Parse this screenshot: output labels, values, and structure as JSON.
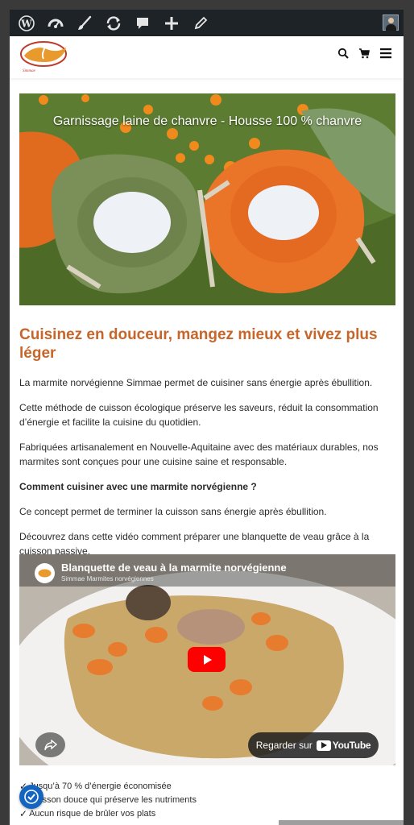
{
  "adminbar": {
    "icons": [
      "wordpress-icon",
      "dashboard-icon",
      "customize-brush-icon",
      "updates-icon",
      "comments-icon",
      "new-content-icon",
      "edit-pencil-icon"
    ],
    "avatar": "user-avatar"
  },
  "header": {
    "logo_text": "Simmae",
    "icons": [
      "search-icon",
      "cart-icon",
      "menu-icon"
    ]
  },
  "hero": {
    "caption": "Garnissage laine de chanvre - Housse 100 % chanvre"
  },
  "article": {
    "heading": "Cuisinez en douceur, mangez mieux et vivez plus léger",
    "paragraphs": [
      "La marmite norvégienne Simmae permet de cuisiner sans énergie après ébullition.",
      "Cette méthode de cuisson écologique préserve les saveurs, réduit la consommation d’énergie et facilite la cuisine du quotidien.",
      "Fabriquées artisanalement en Nouvelle-Aquitaine avec des matériaux durables, nos marmites sont conçues pour une cuisine saine et responsable.",
      "Comment cuisiner avec une marmite norvégienne ?",
      "Ce concept permet de terminer la cuisson sans énergie après ébullition.",
      "Découvrez dans cette vidéo comment préparer une blanquette de veau grâce à la cuisson passive."
    ]
  },
  "video": {
    "title": "Blanquette de veau à la marmite norvégienne",
    "channel": "Simmae Marmites norvégiennes",
    "watch_label": "Regarder sur",
    "youtube_label": "YouTube"
  },
  "checklist": [
    "Jusqu’à 70 % d’énergie économisée",
    "Cuisson douce qui préserve les nutriments",
    "Aucun risque de brûler vos plats"
  ],
  "colors": {
    "accent": "#c7662a",
    "adminbar": "#1d2327",
    "a11y": "#1565c0"
  }
}
